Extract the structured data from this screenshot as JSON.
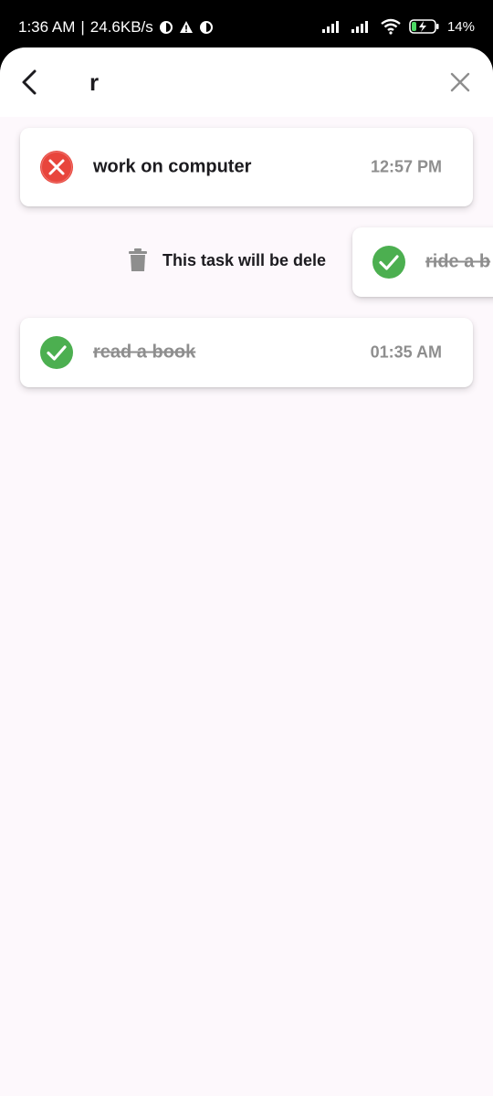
{
  "status_bar": {
    "time": "1:36 AM",
    "network_speed": "24.6KB/s",
    "battery": "14%",
    "icons": [
      "notification-icon",
      "warning-icon",
      "notification-icon",
      "signal-icon",
      "signal-icon",
      "wifi-icon",
      "battery-charging-icon"
    ]
  },
  "search": {
    "query": "r",
    "back_icon": "back-arrow-icon",
    "clear_icon": "close-icon"
  },
  "tasks": [
    {
      "title": "work on computer",
      "time": "12:57 PM",
      "completed": false,
      "status_icon": "x-circle-icon"
    },
    {
      "title": "ride a b",
      "completed": true,
      "status_icon": "check-circle-icon"
    },
    {
      "title": "read a book",
      "time": "01:35 AM",
      "completed": true,
      "status_icon": "check-circle-icon"
    }
  ],
  "delete_hint": {
    "label": "This task will be dele",
    "icon": "trash-icon"
  },
  "colors": {
    "background": "#fdf8fc",
    "pending": "#e8453c",
    "done": "#4caf50",
    "muted_text": "#8e8e8e"
  }
}
